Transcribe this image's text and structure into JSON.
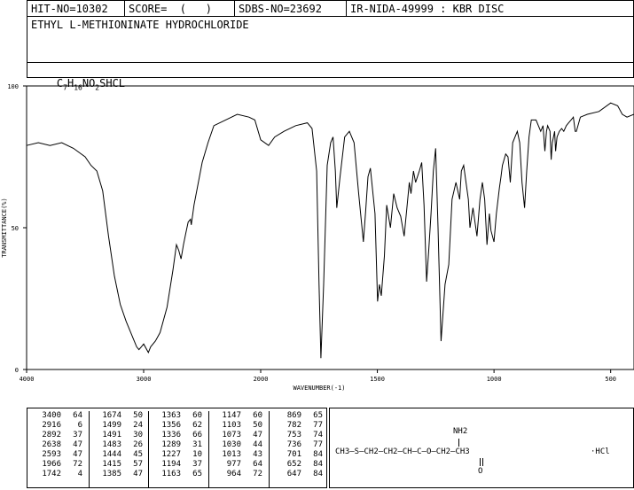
{
  "header": {
    "hit_no": "HIT-NO=10302",
    "score": "SCORE=  (   )",
    "sdbs_no": "SDBS-NO=23692",
    "ir_info": "IR-NIDA-49999 : KBR DISC"
  },
  "compound": {
    "name": "ETHYL L-METHIONINATE HYDROCHLORIDE",
    "formula_parts": [
      "C",
      "7",
      "H",
      "16",
      "NO",
      "2",
      "SHCL"
    ]
  },
  "chart_data": {
    "type": "line",
    "xlabel": "WAVENUMBER(-1)",
    "ylabel": "TRANSMITTANCE(%)",
    "xlim": [
      4000,
      400
    ],
    "ylim": [
      0,
      100
    ],
    "x_ticks": [
      4000,
      3000,
      2000,
      1500,
      1000,
      500
    ],
    "y_ticks": [
      0,
      50,
      100
    ],
    "series": [
      {
        "points": [
          [
            4000,
            79
          ],
          [
            3900,
            80
          ],
          [
            3800,
            79
          ],
          [
            3700,
            80
          ],
          [
            3600,
            78
          ],
          [
            3500,
            75
          ],
          [
            3450,
            72
          ],
          [
            3400,
            70
          ],
          [
            3350,
            63
          ],
          [
            3300,
            47
          ],
          [
            3250,
            33
          ],
          [
            3200,
            23
          ],
          [
            3150,
            17
          ],
          [
            3100,
            12
          ],
          [
            3060,
            8
          ],
          [
            3040,
            7
          ],
          [
            3020,
            8
          ],
          [
            3000,
            9
          ],
          [
            2960,
            6
          ],
          [
            2940,
            8
          ],
          [
            2900,
            10
          ],
          [
            2860,
            13
          ],
          [
            2800,
            22
          ],
          [
            2750,
            35
          ],
          [
            2720,
            44
          ],
          [
            2700,
            42
          ],
          [
            2680,
            39
          ],
          [
            2660,
            44
          ],
          [
            2640,
            48
          ],
          [
            2620,
            52
          ],
          [
            2600,
            53
          ],
          [
            2593,
            51
          ],
          [
            2570,
            58
          ],
          [
            2500,
            73
          ],
          [
            2450,
            80
          ],
          [
            2400,
            86
          ],
          [
            2300,
            88
          ],
          [
            2200,
            90
          ],
          [
            2100,
            89
          ],
          [
            2050,
            88
          ],
          [
            2000,
            81
          ],
          [
            1966,
            79
          ],
          [
            1940,
            82
          ],
          [
            1900,
            84
          ],
          [
            1850,
            86
          ],
          [
            1800,
            87
          ],
          [
            1780,
            85
          ],
          [
            1760,
            70
          ],
          [
            1750,
            30
          ],
          [
            1742,
            4
          ],
          [
            1730,
            30
          ],
          [
            1715,
            72
          ],
          [
            1700,
            80
          ],
          [
            1690,
            82
          ],
          [
            1680,
            70
          ],
          [
            1674,
            57
          ],
          [
            1660,
            68
          ],
          [
            1640,
            82
          ],
          [
            1620,
            84
          ],
          [
            1600,
            80
          ],
          [
            1580,
            62
          ],
          [
            1560,
            45
          ],
          [
            1550,
            56
          ],
          [
            1540,
            68
          ],
          [
            1530,
            71
          ],
          [
            1510,
            55
          ],
          [
            1499,
            24
          ],
          [
            1491,
            30
          ],
          [
            1483,
            26
          ],
          [
            1470,
            40
          ],
          [
            1460,
            58
          ],
          [
            1444,
            50
          ],
          [
            1430,
            62
          ],
          [
            1415,
            57
          ],
          [
            1400,
            54
          ],
          [
            1385,
            47
          ],
          [
            1370,
            60
          ],
          [
            1363,
            66
          ],
          [
            1356,
            62
          ],
          [
            1345,
            70
          ],
          [
            1336,
            66
          ],
          [
            1320,
            70
          ],
          [
            1310,
            73
          ],
          [
            1300,
            58
          ],
          [
            1289,
            31
          ],
          [
            1280,
            42
          ],
          [
            1270,
            55
          ],
          [
            1260,
            70
          ],
          [
            1250,
            78
          ],
          [
            1240,
            50
          ],
          [
            1227,
            10
          ],
          [
            1210,
            30
          ],
          [
            1194,
            37
          ],
          [
            1180,
            60
          ],
          [
            1163,
            66
          ],
          [
            1147,
            60
          ],
          [
            1140,
            70
          ],
          [
            1130,
            72
          ],
          [
            1110,
            60
          ],
          [
            1103,
            50
          ],
          [
            1090,
            57
          ],
          [
            1073,
            47
          ],
          [
            1060,
            60
          ],
          [
            1050,
            66
          ],
          [
            1040,
            60
          ],
          [
            1030,
            44
          ],
          [
            1020,
            55
          ],
          [
            1013,
            49
          ],
          [
            1000,
            45
          ],
          [
            990,
            55
          ],
          [
            977,
            64
          ],
          [
            970,
            68
          ],
          [
            964,
            72
          ],
          [
            950,
            76
          ],
          [
            940,
            75
          ],
          [
            930,
            66
          ],
          [
            920,
            80
          ],
          [
            900,
            84
          ],
          [
            890,
            80
          ],
          [
            880,
            66
          ],
          [
            869,
            57
          ],
          [
            860,
            70
          ],
          [
            850,
            82
          ],
          [
            840,
            88
          ],
          [
            820,
            88
          ],
          [
            800,
            84
          ],
          [
            790,
            86
          ],
          [
            782,
            77
          ],
          [
            775,
            84
          ],
          [
            770,
            86
          ],
          [
            760,
            84
          ],
          [
            755,
            74
          ],
          [
            750,
            80
          ],
          [
            740,
            84
          ],
          [
            736,
            77
          ],
          [
            730,
            82
          ],
          [
            720,
            84
          ],
          [
            710,
            85
          ],
          [
            701,
            84
          ],
          [
            690,
            86
          ],
          [
            680,
            87
          ],
          [
            670,
            88
          ],
          [
            660,
            89
          ],
          [
            652,
            84
          ],
          [
            647,
            84
          ],
          [
            630,
            89
          ],
          [
            600,
            90
          ],
          [
            550,
            91
          ],
          [
            500,
            94
          ],
          [
            470,
            93
          ],
          [
            450,
            90
          ],
          [
            430,
            89
          ],
          [
            400,
            90
          ]
        ]
      }
    ]
  },
  "peak_table": {
    "columns": [
      [
        [
          "3400",
          "64"
        ],
        [
          "2916",
          "6"
        ],
        [
          "2892",
          "37"
        ],
        [
          "2638",
          "47"
        ],
        [
          "2593",
          "47"
        ],
        [
          "1966",
          "72"
        ],
        [
          "1742",
          "4"
        ]
      ],
      [
        [
          "1674",
          "50"
        ],
        [
          "1499",
          "24"
        ],
        [
          "1491",
          "30"
        ],
        [
          "1483",
          "26"
        ],
        [
          "1444",
          "45"
        ],
        [
          "1415",
          "57"
        ],
        [
          "1385",
          "47"
        ]
      ],
      [
        [
          "1363",
          "60"
        ],
        [
          "1356",
          "62"
        ],
        [
          "1336",
          "66"
        ],
        [
          "1289",
          "31"
        ],
        [
          "1227",
          "10"
        ],
        [
          "1194",
          "37"
        ],
        [
          "1163",
          "65"
        ]
      ],
      [
        [
          "1147",
          "60"
        ],
        [
          "1103",
          "50"
        ],
        [
          "1073",
          "47"
        ],
        [
          "1030",
          "44"
        ],
        [
          "1013",
          "43"
        ],
        [
          "977",
          "64"
        ],
        [
          "964",
          "72"
        ]
      ],
      [
        [
          "869",
          "65"
        ],
        [
          "782",
          "77"
        ],
        [
          "753",
          "74"
        ],
        [
          "736",
          "77"
        ],
        [
          "701",
          "84"
        ],
        [
          "652",
          "84"
        ],
        [
          "647",
          "84"
        ]
      ]
    ]
  },
  "structure": {
    "chain": "CH3—S—CH2—CH2—CH—C—O—CH2—CH3",
    "amino": "NH2",
    "carbonyl_o": "O",
    "salt": "·HCl"
  }
}
